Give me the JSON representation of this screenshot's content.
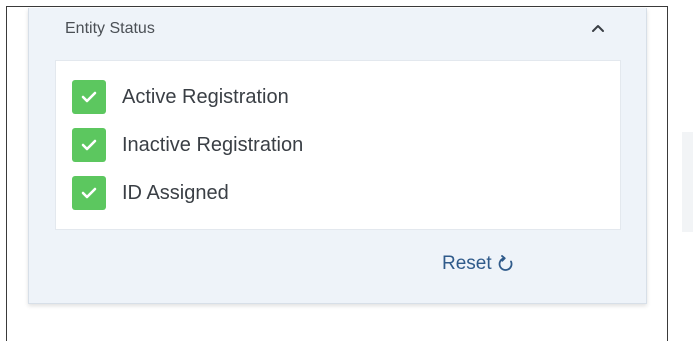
{
  "panel": {
    "title": "Entity Status",
    "collapse_icon": "chevron-up-icon"
  },
  "filters": [
    {
      "label": "Active Registration",
      "checked": true
    },
    {
      "label": "Inactive Registration",
      "checked": true
    },
    {
      "label": "ID Assigned",
      "checked": true
    }
  ],
  "reset": {
    "label": "Reset",
    "icon": "refresh-icon"
  },
  "colors": {
    "panel_bg": "#eef3f9",
    "checkbox_checked": "#5cc75f",
    "reset_text": "#2f5a8a",
    "label_text": "#3a3f45"
  }
}
